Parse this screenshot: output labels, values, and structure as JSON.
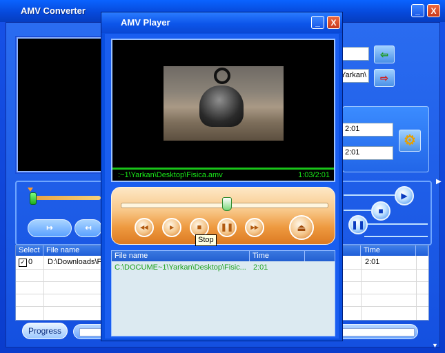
{
  "converter": {
    "title": "AMV Converter",
    "min_glyph": "_",
    "close_glyph": "X",
    "path_field_1": "",
    "path_field_2": "Yarkan\\",
    "time_field_1": "2:01",
    "time_field_2": "2:01",
    "table": {
      "headers": [
        "Select",
        "File name",
        "Time"
      ],
      "rows": [
        {
          "select": "0",
          "file": "D:\\Downloads\\F",
          "time": "2:01"
        }
      ]
    },
    "progress_label": "Progress"
  },
  "player": {
    "title": "AMV Player",
    "min_glyph": "_",
    "close_glyph": "X",
    "status_path": ":~1\\Yarkan\\Desktop\\Fisica.amv",
    "status_time": "1:03/2:01",
    "seek_position": 0.51,
    "tooltip": "Stop",
    "buttons": {
      "rewind": "◂◂",
      "play": "▸",
      "stop": "■",
      "pause": "❚❚",
      "forward": "▸▸",
      "eject": "⏏"
    },
    "playlist": {
      "headers": [
        "File name",
        "Time"
      ],
      "rows": [
        {
          "file": "C:\\DOCUME~1\\Yarkan\\Desktop\\Fisic...",
          "time": "2:01"
        }
      ]
    }
  }
}
